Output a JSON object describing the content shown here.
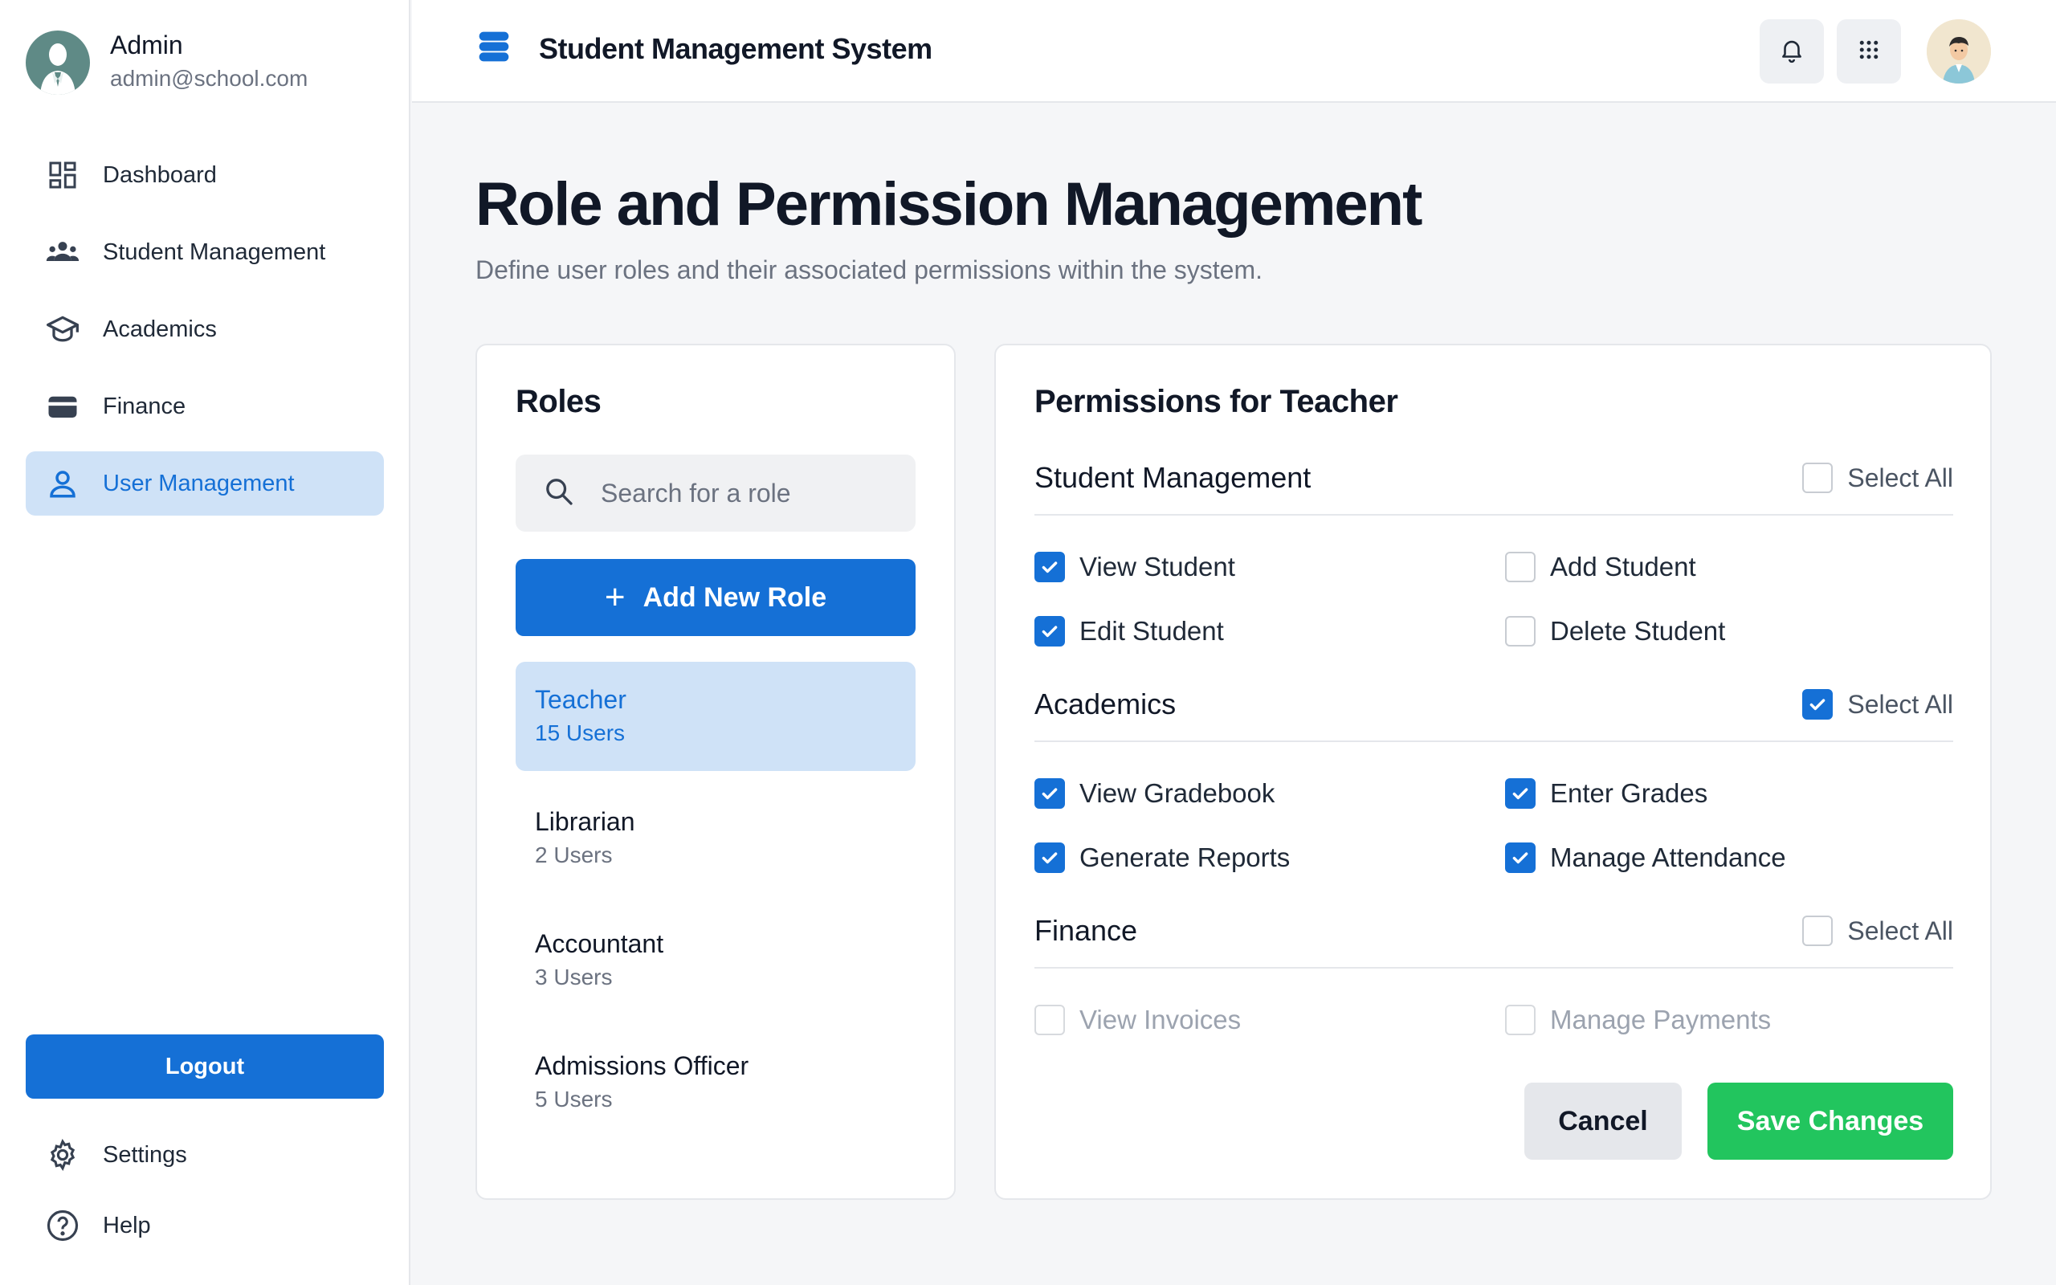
{
  "user": {
    "name": "Admin",
    "email": "admin@school.com"
  },
  "sidebar": {
    "items": [
      {
        "label": "Dashboard",
        "icon": "dashboard-icon"
      },
      {
        "label": "Student Management",
        "icon": "users-icon"
      },
      {
        "label": "Academics",
        "icon": "graduation-cap-icon"
      },
      {
        "label": "Finance",
        "icon": "wallet-icon"
      },
      {
        "label": "User Management",
        "icon": "user-icon",
        "active": true
      }
    ],
    "logout_label": "Logout",
    "bottom_items": [
      {
        "label": "Settings",
        "icon": "gear-icon"
      },
      {
        "label": "Help",
        "icon": "help-icon"
      }
    ]
  },
  "header": {
    "title": "Student Management System"
  },
  "page": {
    "title": "Role and Permission Management",
    "subtitle": "Define user roles and their associated permissions within the system."
  },
  "roles": {
    "title": "Roles",
    "search_placeholder": "Search for a role",
    "add_label": "Add New Role",
    "list": [
      {
        "name": "Teacher",
        "count": "15 Users",
        "active": true
      },
      {
        "name": "Librarian",
        "count": "2 Users"
      },
      {
        "name": "Accountant",
        "count": "3 Users"
      },
      {
        "name": "Admissions Officer",
        "count": "5 Users"
      }
    ]
  },
  "permissions": {
    "title": "Permissions for Teacher",
    "select_all_label": "Select All",
    "sections": [
      {
        "title": "Student Management",
        "select_all": false,
        "items": [
          {
            "label": "View Student",
            "checked": true
          },
          {
            "label": "Add Student",
            "checked": false
          },
          {
            "label": "Edit Student",
            "checked": true
          },
          {
            "label": "Delete Student",
            "checked": false
          }
        ]
      },
      {
        "title": "Academics",
        "select_all": true,
        "items": [
          {
            "label": "View Gradebook",
            "checked": true
          },
          {
            "label": "Enter Grades",
            "checked": true
          },
          {
            "label": "Generate Reports",
            "checked": true
          },
          {
            "label": "Manage Attendance",
            "checked": true
          }
        ]
      },
      {
        "title": "Finance",
        "select_all": false,
        "items": [
          {
            "label": "View Invoices",
            "checked": false,
            "disabled": true
          },
          {
            "label": "Manage Payments",
            "checked": false,
            "disabled": true
          }
        ]
      }
    ],
    "cancel_label": "Cancel",
    "save_label": "Save Changes"
  },
  "colors": {
    "primary": "#1570d6",
    "success": "#22c55e",
    "active_bg": "#cfe2f7"
  }
}
